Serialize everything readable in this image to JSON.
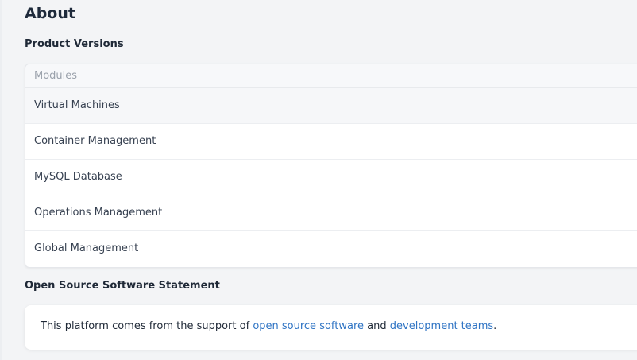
{
  "page": {
    "title": "About"
  },
  "product_versions": {
    "title": "Product Versions",
    "table_header": "Modules",
    "modules": [
      "Virtual Machines",
      "Container Management",
      "MySQL Database",
      "Operations Management",
      "Global Management"
    ]
  },
  "oss_statement": {
    "title": "Open Source Software Statement",
    "text_before": "This platform comes from the support of",
    "link1": "open source software",
    "text_middle": "and",
    "link2": "development teams",
    "text_after": "."
  },
  "colors": {
    "background": "#f3f4f6",
    "link": "#2f74c4",
    "title": "#1e2a3b"
  }
}
